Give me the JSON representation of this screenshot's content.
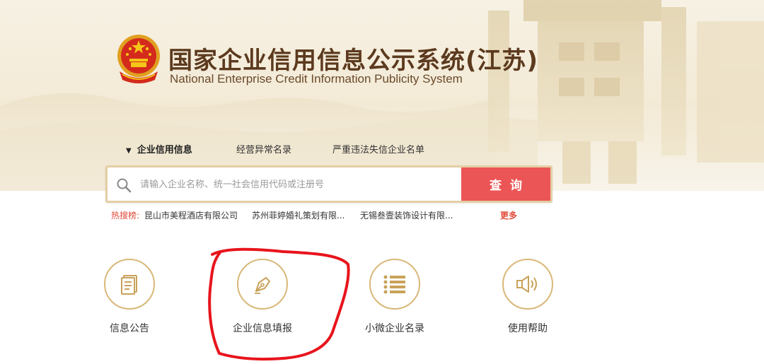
{
  "header": {
    "title_cn": "国家企业信用信息公示系统(江苏)",
    "title_en": "National Enterprise Credit Information Publicity System"
  },
  "tabs": [
    {
      "label": "企业信用信息",
      "active": true
    },
    {
      "label": "经营异常名录",
      "active": false
    },
    {
      "label": "严重违法失信企业名单",
      "active": false
    }
  ],
  "search": {
    "placeholder": "请输入企业名称、统一社会信用代码或注册号",
    "value": "",
    "button_label": "查询"
  },
  "hot_search": {
    "label": "热搜榜:",
    "items": [
      "昆山市美程酒店有限公司",
      "苏州菲婷婚礼策划有限...",
      "无锡叁壹装饰设计有限..."
    ],
    "more_label": "更多"
  },
  "functions": [
    {
      "label": "信息公告",
      "icon": "document-icon"
    },
    {
      "label": "企业信息填报",
      "icon": "pen-nib-icon"
    },
    {
      "label": "小微企业名录",
      "icon": "list-icon"
    },
    {
      "label": "使用帮助",
      "icon": "speaker-icon"
    }
  ],
  "colors": {
    "accent_red": "#ec5555",
    "gold": "#d9b879",
    "title_brown": "#5c3a1e",
    "annotation_red": "#e8141c"
  }
}
